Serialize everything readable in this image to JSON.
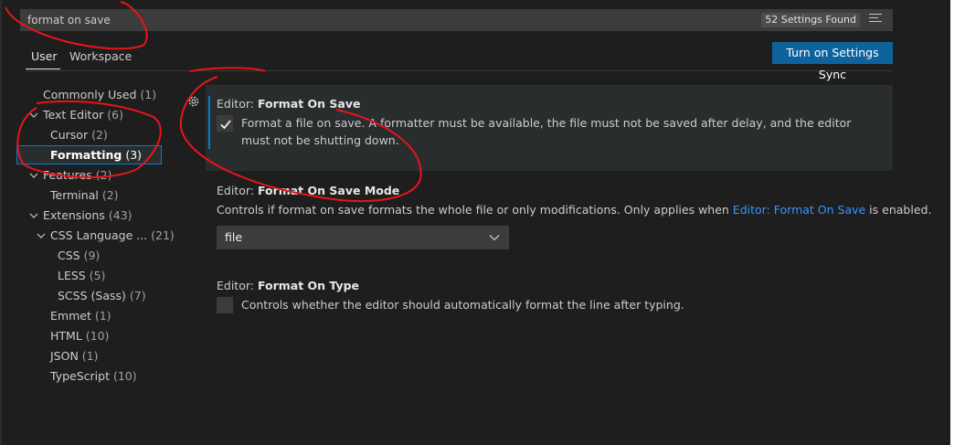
{
  "search": {
    "value": "format on save",
    "result_count": "52 Settings Found"
  },
  "tabs": [
    {
      "label": "User"
    },
    {
      "label": "Workspace"
    }
  ],
  "sync_button": {
    "label": "Turn on Settings Sync"
  },
  "toc": {
    "commonly_used": {
      "label": "Commonly Used",
      "count": "(1)"
    },
    "text_editor": {
      "label": "Text Editor",
      "count": "(6)"
    },
    "cursor": {
      "label": "Cursor",
      "count": "(2)"
    },
    "formatting": {
      "label": "Formatting",
      "count": "(3)"
    },
    "features": {
      "label": "Features",
      "count": "(2)"
    },
    "terminal": {
      "label": "Terminal",
      "count": "(2)"
    },
    "extensions": {
      "label": "Extensions",
      "count": "(43)"
    },
    "css_language": {
      "label": "CSS Language ...",
      "count": "(21)"
    },
    "css": {
      "label": "CSS",
      "count": "(9)"
    },
    "less": {
      "label": "LESS",
      "count": "(5)"
    },
    "scss": {
      "label": "SCSS (Sass)",
      "count": "(7)"
    },
    "emmet": {
      "label": "Emmet",
      "count": "(1)"
    },
    "html": {
      "label": "HTML",
      "count": "(10)"
    },
    "json": {
      "label": "JSON",
      "count": "(1)"
    },
    "typescript": {
      "label": "TypeScript",
      "count": "(10)"
    }
  },
  "settings": {
    "format_on_save": {
      "category": "Editor: ",
      "name": "Format On Save",
      "description": "Format a file on save. A formatter must be available, the file must not be saved after delay, and the editor must not be shutting down.",
      "checked": true
    },
    "format_on_save_mode": {
      "category": "Editor: ",
      "name": "Format On Save Mode",
      "description_prefix": "Controls if format on save formats the whole file or only modifications. Only applies when ",
      "link": "Editor: Format On Save",
      "description_suffix": " is enabled.",
      "value": "file"
    },
    "format_on_type": {
      "category": "Editor: ",
      "name": "Format On Type",
      "description": "Controls whether the editor should automatically format the line after typing.",
      "checked": false
    }
  },
  "colors": {
    "accent": "#007fd4",
    "button": "#0e639c",
    "annotation": "#e8141b",
    "link": "#3794ff"
  },
  "icons": [
    "filter-icon",
    "gear-icon",
    "chevron-down-icon",
    "checkmark-icon"
  ]
}
